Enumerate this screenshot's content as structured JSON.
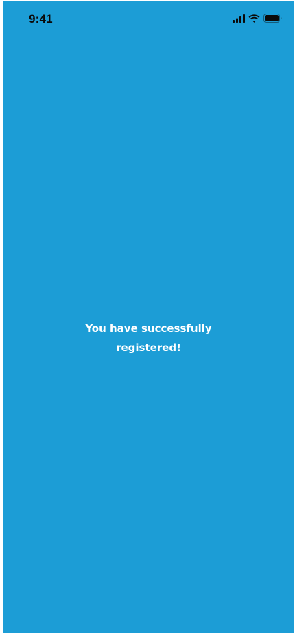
{
  "status_bar": {
    "time": "9:41",
    "icons": [
      "signal-icon",
      "wifi-icon",
      "battery-icon"
    ]
  },
  "success_message": {
    "line1": "You have successfully",
    "line2": "registered!"
  },
  "colors": {
    "background": "#1c9dd6",
    "text": "#ffffff",
    "status_text": "#0a0a0a"
  }
}
